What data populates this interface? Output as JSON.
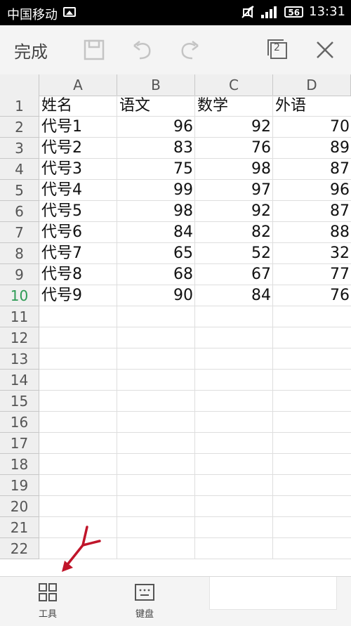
{
  "status_bar": {
    "carrier": "中国移动",
    "battery": "56",
    "time": "13:31"
  },
  "toolbar": {
    "done_label": "完成",
    "window_count": "2"
  },
  "sheet": {
    "columns": [
      "A",
      "B",
      "C",
      "D"
    ],
    "active_row": 10,
    "rows": [
      {
        "num": "1",
        "cells": [
          "姓名",
          "语文",
          "数学",
          "外语"
        ]
      },
      {
        "num": "2",
        "cells": [
          "代号1",
          "96",
          "92",
          "70"
        ]
      },
      {
        "num": "3",
        "cells": [
          "代号2",
          "83",
          "76",
          "89"
        ]
      },
      {
        "num": "4",
        "cells": [
          "代号3",
          "75",
          "98",
          "87"
        ]
      },
      {
        "num": "5",
        "cells": [
          "代号4",
          "99",
          "97",
          "96"
        ]
      },
      {
        "num": "6",
        "cells": [
          "代号5",
          "98",
          "92",
          "87"
        ]
      },
      {
        "num": "7",
        "cells": [
          "代号6",
          "84",
          "82",
          "88"
        ]
      },
      {
        "num": "8",
        "cells": [
          "代号7",
          "65",
          "52",
          "32"
        ]
      },
      {
        "num": "9",
        "cells": [
          "代号8",
          "68",
          "67",
          "77"
        ]
      },
      {
        "num": "10",
        "cells": [
          "代号9",
          "90",
          "84",
          "76"
        ]
      },
      {
        "num": "11",
        "cells": [
          "",
          "",
          "",
          ""
        ]
      },
      {
        "num": "12",
        "cells": [
          "",
          "",
          "",
          ""
        ]
      },
      {
        "num": "13",
        "cells": [
          "",
          "",
          "",
          ""
        ]
      },
      {
        "num": "14",
        "cells": [
          "",
          "",
          "",
          ""
        ]
      },
      {
        "num": "15",
        "cells": [
          "",
          "",
          "",
          ""
        ]
      },
      {
        "num": "16",
        "cells": [
          "",
          "",
          "",
          ""
        ]
      },
      {
        "num": "17",
        "cells": [
          "",
          "",
          "",
          ""
        ]
      },
      {
        "num": "18",
        "cells": [
          "",
          "",
          "",
          ""
        ]
      },
      {
        "num": "19",
        "cells": [
          "",
          "",
          "",
          ""
        ]
      },
      {
        "num": "20",
        "cells": [
          "",
          "",
          "",
          ""
        ]
      },
      {
        "num": "21",
        "cells": [
          "",
          "",
          "",
          ""
        ]
      },
      {
        "num": "22",
        "cells": [
          "",
          "",
          "",
          ""
        ]
      }
    ]
  },
  "bottom_bar": {
    "tools_label": "工具",
    "keyboard_label": "键盘"
  },
  "colors": {
    "active_row_number": "#2e9b55",
    "annotation_arrow": "#c0152a"
  },
  "icons": [
    "picture-icon",
    "mute-icon",
    "signal-icon",
    "save-icon",
    "undo-icon",
    "redo-icon",
    "windows-icon",
    "close-icon",
    "grid-tools-icon",
    "keyboard-icon"
  ]
}
